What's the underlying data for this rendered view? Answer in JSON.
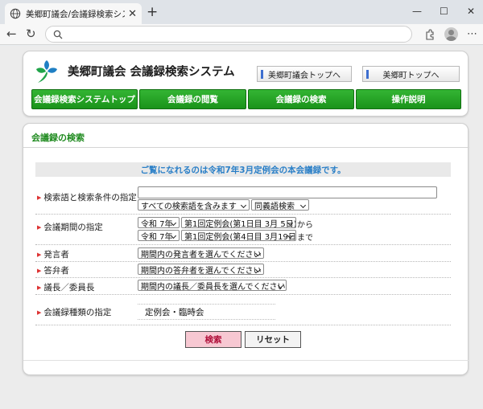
{
  "browser": {
    "tab_title": "美郷町議会/会議録検索システム",
    "close_glyph": "✕",
    "new_tab_glyph": "+",
    "minimize_glyph": "—",
    "maximize_glyph": "☐",
    "window_close_glyph": "✕",
    "back_glyph": "←",
    "reload_glyph": "↻",
    "menu_glyph": "⋯",
    "address": ""
  },
  "header": {
    "site_title": "美郷町議会 会議録検索システム",
    "toplinks": [
      "美郷町議会トップへ",
      "美郷町トップへ"
    ],
    "nav": [
      "会議録検索システムトップ",
      "会議録の閲覧",
      "会議録の検索",
      "操作説明"
    ]
  },
  "search": {
    "section_title": "会議録の検索",
    "notice": "ご覧になれるのは令和7年3月定例会の本会議録です。",
    "keyword": {
      "label": "検索語と検索条件の指定",
      "value": "",
      "condition": "すべての検索語を含みます",
      "synonym": "同義語検索"
    },
    "period": {
      "label": "会議期間の指定",
      "from_era": "令和 7年",
      "from_session": "第1回定例会(第1日目 3月 5日)",
      "from_suffix": "から",
      "to_era": "令和 7年",
      "to_session": "第1回定例会(第4日目 3月19日)",
      "to_suffix": "まで"
    },
    "speaker": {
      "label": "発言者",
      "value": "期間内の発言者を選んでください"
    },
    "answerer": {
      "label": "答弁者",
      "value": "期間内の答弁者を選んでください"
    },
    "chair": {
      "label": "議長／委員長",
      "value": "期間内の議長／委員長を選んでください"
    },
    "kind": {
      "label": "会議録種類の指定",
      "value": "定例会・臨時会"
    },
    "search_button": "検索",
    "reset_button": "リセット"
  },
  "colors": {
    "accent_green": "#1a931a",
    "notice_blue": "#2a7fc7",
    "search_button_bg": "#f7c8d2"
  }
}
